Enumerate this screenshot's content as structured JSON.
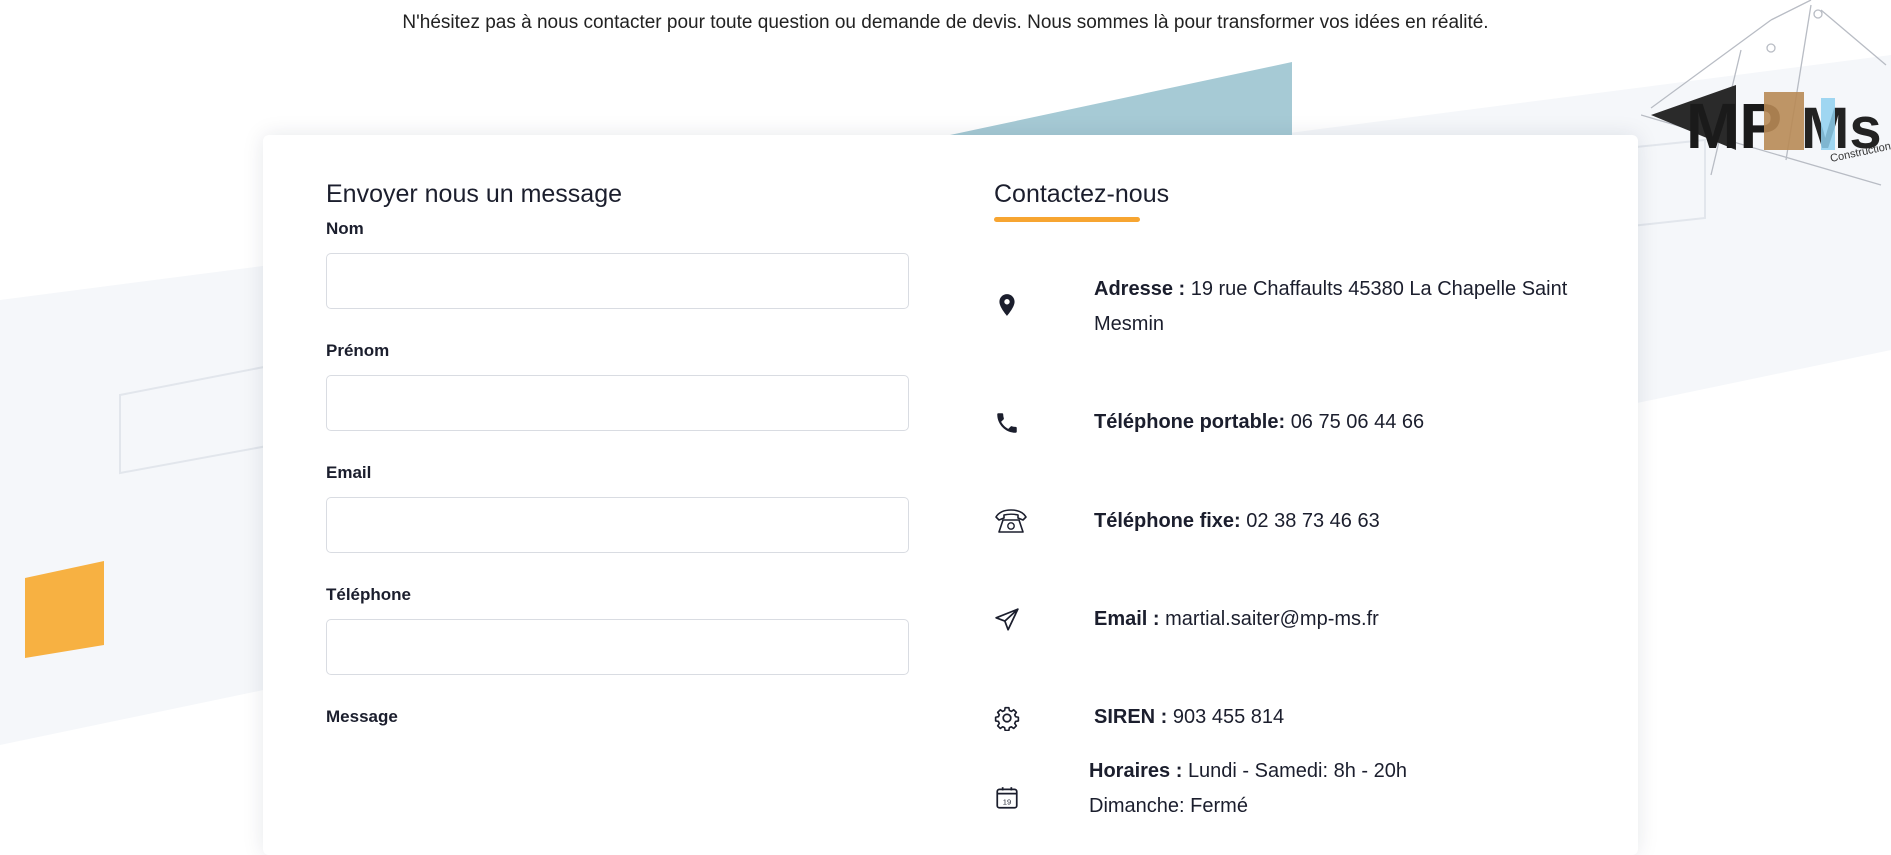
{
  "intro_text": "N'hésitez pas à nous contacter pour toute question ou demande de devis. Nous sommes là pour transformer vos idées en réalité.",
  "logo": {
    "text_primary": "MPMS",
    "text_secondary": "Construction"
  },
  "colors": {
    "accent": "#f7a531",
    "teal": "#a6cad5",
    "text": "#1b1e2d"
  },
  "form": {
    "title": "Envoyer nous un message",
    "fields": [
      {
        "label": "Nom",
        "value": ""
      },
      {
        "label": "Prénom",
        "value": ""
      },
      {
        "label": "Email",
        "value": ""
      },
      {
        "label": "Téléphone",
        "value": ""
      },
      {
        "label": "Message",
        "value": ""
      }
    ]
  },
  "contact": {
    "title": "Contactez-nous",
    "items": [
      {
        "icon": "location-pin-icon",
        "label": "Adresse :",
        "value": "19 rue Chaffaults 45380 La Chapelle Saint Mesmin"
      },
      {
        "icon": "mobile-phone-icon",
        "label": "Téléphone portable:",
        "value": "06 75 06 44 66"
      },
      {
        "icon": "landline-phone-icon",
        "label": "Téléphone fixe:",
        "value": "02 38 73 46 63"
      },
      {
        "icon": "paper-plane-icon",
        "label": "Email :",
        "value": "martial.saiter@mp-ms.fr"
      },
      {
        "icon": "gear-icon",
        "label": "SIREN :",
        "value": "903 455 814"
      },
      {
        "icon": "calendar-icon",
        "icon_text": "19",
        "label": "Horaires :",
        "value": "Lundi - Samedi: 8h - 20h",
        "value2": "Dimanche: Fermé"
      }
    ]
  }
}
